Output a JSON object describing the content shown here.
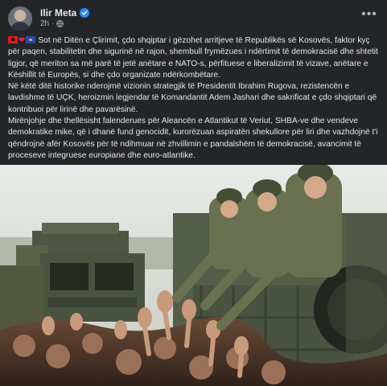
{
  "post": {
    "author": "Ilir Meta",
    "time": "2h",
    "privacy_icon": "globe-icon",
    "verified_icon": "verified-badge-icon",
    "more_icon": "more-options-icon",
    "paragraphs": [
      "Sot në Ditën e Çlirimit, çdo shqiptar i gëzohet arritjeve të Republikës së Kosovës, faktor kyç për paqen, stabilitetin dhe sigurinë në rajon, shembull frymëzues i ndërtimit të demokracisë dhe shtetit ligjor, që meriton sa më parë të jetë anëtare e NATO-s, përfituese e liberalizimit të vizave, anëtare e Këshillit të Europës, si dhe çdo organizate ndërkombëtare.",
      "Në këtë ditë historike nderojmë vizionin strategjik të Presidentit Ibrahim Rugova, rezistencën e lavdishme të UÇK, heroizmin legjendar të Komandantit Adem Jashari dhe sakrificat e çdo shqiptari që kontribuoi për lirinë dhe pavarësinë.",
      "Mirënjohje dhe thellësisht falenderues për Aleancën e Atlantikut të Veriut, SHBA-ve dhe vendeve demokratike mike, që i dhanë fund genocidit, kurorëzuan aspiratën shekullore për liri dhe vazhdojnë t'i qëndrojnë afër Kosovës për të ndihmuar në zhvillimin e pandalshëm të demokracisë, avancimit të proceseve integruese europiane dhe euro-atlantike."
    ]
  }
}
